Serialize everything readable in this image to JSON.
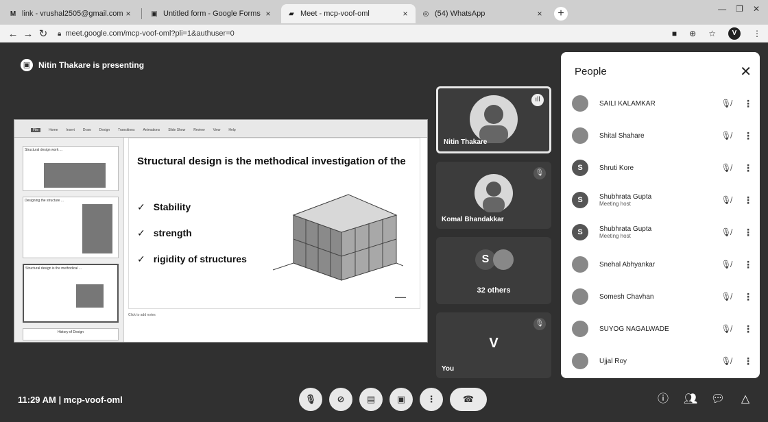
{
  "browser": {
    "tabs": [
      {
        "icon": "M",
        "title": "link - vrushal2505@gmail.com -",
        "active": false
      },
      {
        "icon": "▣",
        "title": "Untitled form - Google Forms",
        "active": false
      },
      {
        "icon": "▰",
        "title": "Meet - mcp-voof-oml",
        "active": true
      },
      {
        "icon": "◎",
        "title": "(54) WhatsApp",
        "active": false
      }
    ],
    "new_tab_label": "+",
    "url": "meet.google.com/mcp-voof-oml?pli=1&authuser=0",
    "profile_initial": "V"
  },
  "meet": {
    "presenting_text": "Nitin Thakare is presenting",
    "slide": {
      "title": "Structural design is the methodical investigation of the",
      "bullets": [
        "Stability",
        "strength",
        "rigidity of structures"
      ],
      "check": "✓",
      "notes": "Click to add notes"
    },
    "thumbnails": [
      {
        "caption": "Structural design work ..."
      },
      {
        "caption": "Designing the structure ..."
      },
      {
        "caption": "Structural design is the methodical ..."
      },
      {
        "caption": "History of Design"
      }
    ],
    "tiles": [
      {
        "name": "Nitin Thakare",
        "initial": "",
        "speaking": true
      },
      {
        "name": "Komal Bhandakkar",
        "initial": "",
        "speaking": false
      },
      {
        "name": "",
        "initial": "S",
        "others": "32 others"
      },
      {
        "name": "You",
        "initial": "V",
        "speaking": false
      }
    ],
    "people_panel": {
      "title": "People",
      "close": "✕",
      "people": [
        {
          "name": "SAILI KALAMKAR",
          "sub": "",
          "initial": "",
          "photo": true
        },
        {
          "name": "Shital Shahare",
          "sub": "",
          "initial": "",
          "photo": true
        },
        {
          "name": "Shruti Kore",
          "sub": "",
          "initial": "S",
          "photo": false
        },
        {
          "name": "Shubhrata Gupta",
          "sub": "Meeting host",
          "initial": "S",
          "photo": false
        },
        {
          "name": "Shubhrata Gupta",
          "sub": "Meeting host",
          "initial": "S",
          "photo": false
        },
        {
          "name": "Snehal Abhyankar",
          "sub": "",
          "initial": "",
          "photo": true
        },
        {
          "name": "Somesh Chavhan",
          "sub": "",
          "initial": "",
          "photo": true
        },
        {
          "name": "SUYOG NAGALWADE",
          "sub": "",
          "initial": "",
          "photo": true
        },
        {
          "name": "Ujjal Roy",
          "sub": "",
          "initial": "",
          "photo": true
        }
      ]
    },
    "bottom_bar": {
      "time": "11:29 AM",
      "separator": "|",
      "meeting_code": "mcp-voof-oml"
    }
  },
  "colors": {
    "panel_bg": "#ffffff",
    "stage_bg": "#303030",
    "tile_bg": "#3c3c3c"
  }
}
